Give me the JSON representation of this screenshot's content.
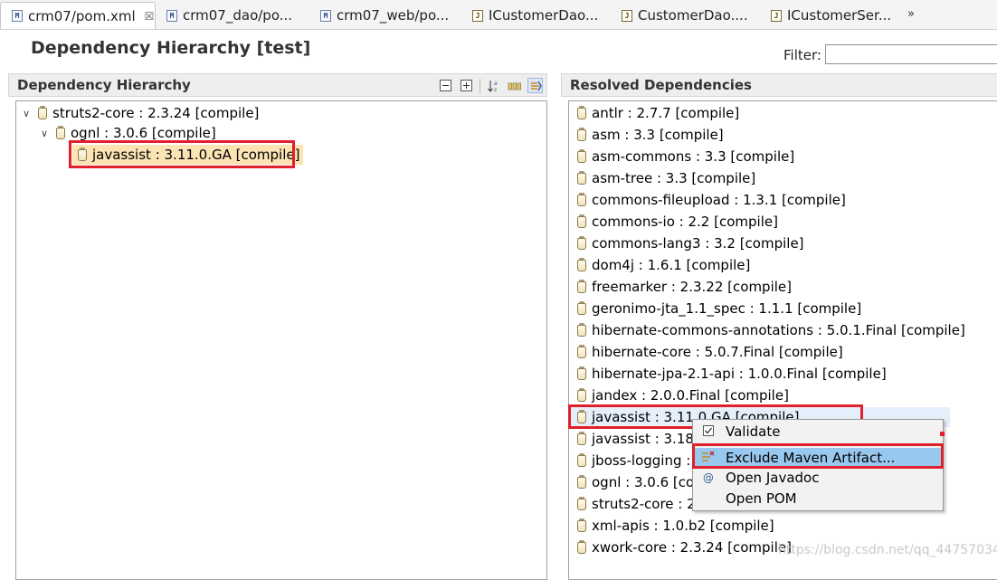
{
  "tabs": [
    {
      "label": "crm07/pom.xml",
      "icon": "maven-pom-icon",
      "active": true
    },
    {
      "label": "crm07_dao/po...",
      "icon": "maven-pom-icon"
    },
    {
      "label": "crm07_web/po...",
      "icon": "maven-pom-icon"
    },
    {
      "label": "ICustomerDao...",
      "icon": "java-file-icon"
    },
    {
      "label": "CustomerDao....",
      "icon": "java-file-icon"
    },
    {
      "label": "ICustomerSer...",
      "icon": "java-file-icon"
    }
  ],
  "tab_close": "☒",
  "tab_overflow": "»",
  "header": {
    "title": "Dependency Hierarchy [test]",
    "filter_label": "Filter:",
    "filter_value": ""
  },
  "hierarchy": {
    "title": "Dependency Hierarchy",
    "rows": [
      {
        "label": "struts2-core : 2.3.24 [compile]",
        "expanded": true
      },
      {
        "label": "ognl : 3.0.6 [compile]",
        "expanded": true
      },
      {
        "label": "javassist : 3.11.0.GA [compile]",
        "selected": true
      }
    ]
  },
  "resolved": {
    "title": "Resolved Dependencies",
    "rows": [
      "antlr : 2.7.7 [compile]",
      "asm : 3.3 [compile]",
      "asm-commons : 3.3 [compile]",
      "asm-tree : 3.3 [compile]",
      "commons-fileupload : 1.3.1 [compile]",
      "commons-io : 2.2 [compile]",
      "commons-lang3 : 3.2 [compile]",
      "dom4j : 1.6.1 [compile]",
      "freemarker : 2.3.22 [compile]",
      "geronimo-jta_1.1_spec : 1.1.1 [compile]",
      "hibernate-commons-annotations : 5.0.1.Final [compile]",
      "hibernate-core : 5.0.7.Final [compile]",
      "hibernate-jpa-2.1-api : 1.0.0.Final [compile]",
      "jandex : 2.0.0.Final [compile]",
      "javassist : 3.11.0.GA [compile]",
      "javassist : 3.18.1",
      "jboss-logging :",
      "ognl : 3.0.6 [com",
      "struts2-core : 2.",
      "xml-apis : 1.0.b2 [compile]",
      "xwork-core : 2.3.24 [compile]"
    ]
  },
  "context_menu": [
    {
      "label": "Validate",
      "icon": "check-icon"
    },
    {
      "label": "Exclude Maven Artifact...",
      "icon": "exclude-icon",
      "active": true
    },
    {
      "label": "Open Javadoc",
      "icon": "at-icon"
    },
    {
      "label": "Open POM",
      "icon": ""
    }
  ],
  "watermark": "https://blog.csdn.net/qq_44757034",
  "colors": {
    "highlight": "#e0202a",
    "selection": "#fbe3b4",
    "menu_active": "#99c8ef"
  }
}
